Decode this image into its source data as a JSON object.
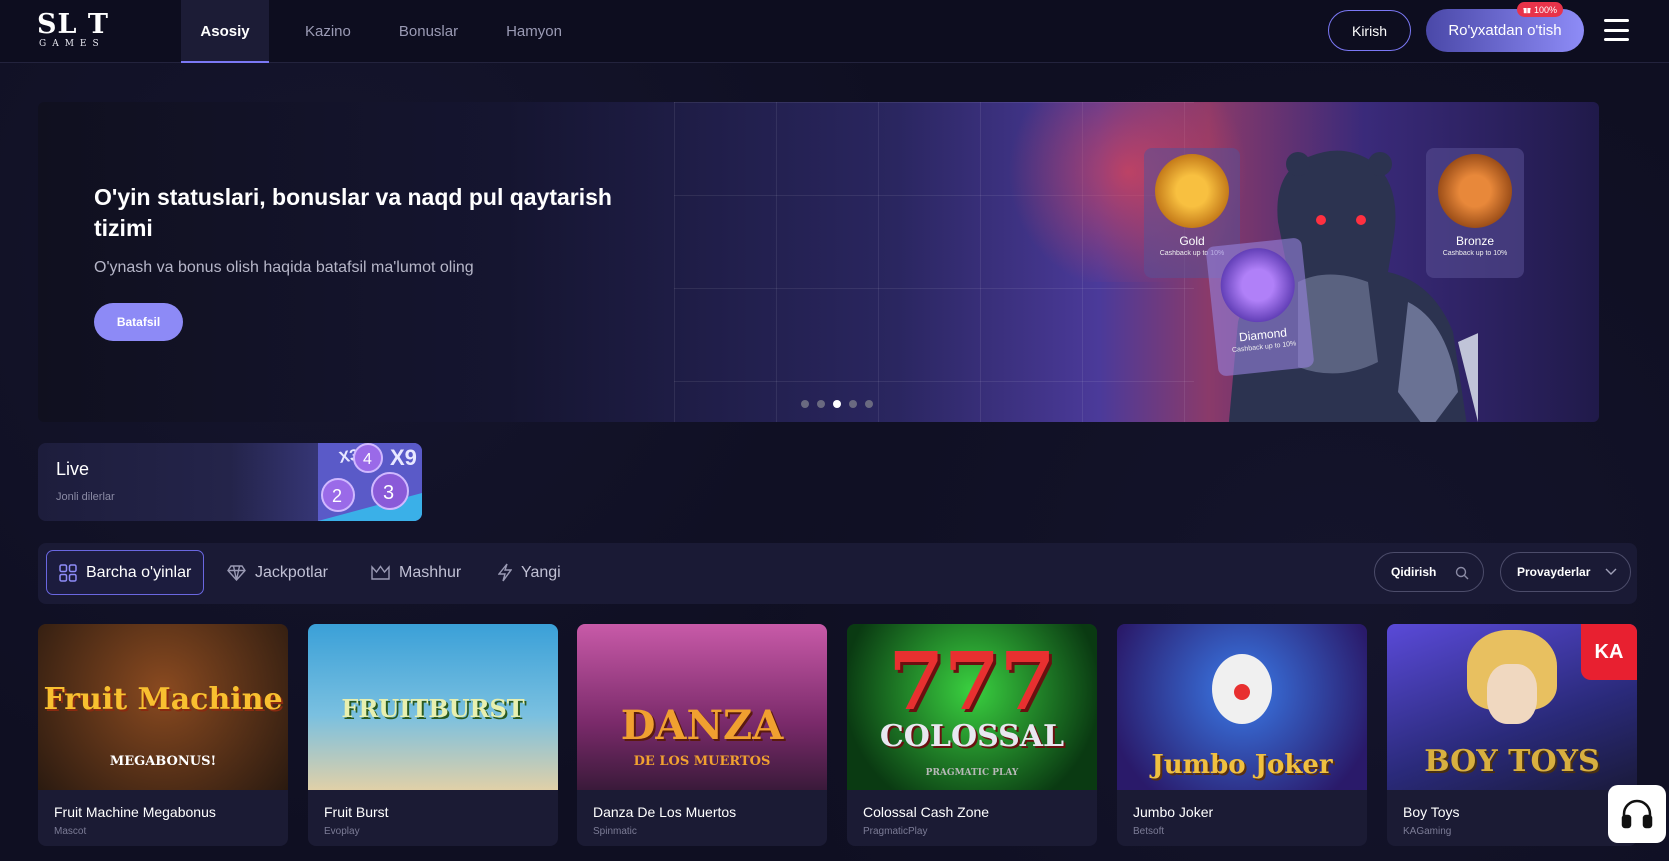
{
  "header": {
    "logo_top": "SL T",
    "logo_bottom": "GAMES",
    "nav": [
      {
        "label": "Asosiy",
        "active": true
      },
      {
        "label": "Kazino",
        "active": false
      },
      {
        "label": "Bonuslar",
        "active": false
      },
      {
        "label": "Hamyon",
        "active": false
      }
    ],
    "login_label": "Kirish",
    "register_label": "Ro'yxatdan o'tish",
    "register_badge": "100%",
    "menu_icon": "hamburger-menu-icon"
  },
  "banner": {
    "title": "O'yin statuslari, bonuslar va naqd pul qaytarish tizimi",
    "subtitle": "O'ynash va bonus olish haqida batafsil ma'lumot oling",
    "button_label": "Batafsil",
    "active_slide": 3,
    "slide_count": 5,
    "cards": [
      {
        "name": "Gold",
        "cashback": "Cashback up to 10%"
      },
      {
        "name": "Bronze",
        "cashback": "Cashback up to 10%"
      },
      {
        "name": "Diamond",
        "cashback": "Cashback up to 10%"
      }
    ]
  },
  "live": {
    "title": "Live",
    "subtitle": "Jonli dilerlar",
    "art": {
      "x3": "X3",
      "x9": "X9",
      "b4": "4",
      "b2": "2",
      "b3": "3"
    }
  },
  "filters": {
    "items": [
      {
        "label": "Barcha o'yinlar",
        "icon": "grid-icon",
        "active": true
      },
      {
        "label": "Jackpotlar",
        "icon": "diamond-icon",
        "active": false
      },
      {
        "label": "Mashhur",
        "icon": "crown-icon",
        "active": false
      },
      {
        "label": "Yangi",
        "icon": "lightning-icon",
        "active": false
      }
    ],
    "search_placeholder": "Qidirish",
    "providers_label": "Provayderlar"
  },
  "games": [
    {
      "name": "Fruit Machine Megabonus",
      "provider": "Mascot",
      "art_text": "Fruit Machine",
      "art_sub": "MEGABONUS!",
      "color_top": "#2a1a10",
      "color_bottom": "#6a2a10",
      "art_color": "#f0a020"
    },
    {
      "name": "Fruit Burst",
      "provider": "Evoplay",
      "art_text": "FRUITBURST",
      "art_sub": "",
      "color_top": "#3aa0d8",
      "color_bottom": "#e8d8b0",
      "art_color": "#e8e0a0"
    },
    {
      "name": "Danza De Los Muertos",
      "provider": "Spinmatic",
      "art_text": "DANZA",
      "art_sub": "DE LOS MUERTOS",
      "color_top": "#b84a9a",
      "color_bottom": "#3a1a3a",
      "art_color": "#f0a030"
    },
    {
      "name": "Colossal Cash Zone",
      "provider": "PragmaticPlay",
      "art_text": "COLOSSAL",
      "art_sub": "PRAGMATIC PLAY",
      "color_top": "#1a8a2a",
      "color_bottom": "#0a3a12",
      "art_color": "#e8e8f0"
    },
    {
      "name": "Jumbo Joker",
      "provider": "Betsoft",
      "art_text": "Jumbo Joker",
      "art_sub": "",
      "color_top": "#2a4ab8",
      "color_bottom": "#4a2a8a",
      "art_color": "#f0c040"
    },
    {
      "name": "Boy Toys",
      "provider": "KAGaming",
      "art_text": "BOY TOYS",
      "art_sub": "",
      "color_top": "#4a3ab8",
      "color_bottom": "#1a1a4a",
      "art_color": "#d8b040"
    }
  ],
  "provider_logo_ka": "KA",
  "support_icon": "headset-icon"
}
